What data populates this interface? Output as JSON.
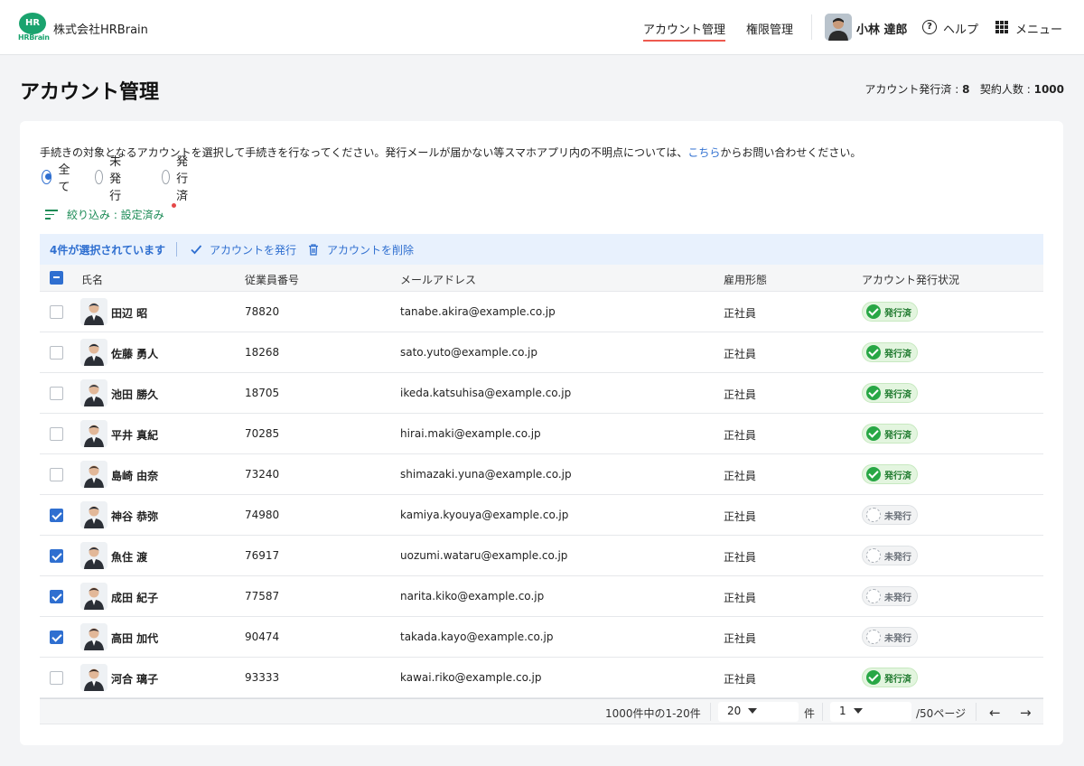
{
  "header": {
    "logo_text": "HR",
    "logo_sub": "HRBrain",
    "company": "株式会社HRBrain",
    "nav": [
      "アカウント管理",
      "権限管理"
    ],
    "user_name": "小林 達郎",
    "help_label": "ヘルプ",
    "menu_label": "メニュー"
  },
  "page": {
    "title": "アカウント管理",
    "issued_label": "アカウント発行済 : ",
    "issued_count": "8",
    "contract_label": "契約人数 : ",
    "contract_count": "1000"
  },
  "card": {
    "desc_before": "手続きの対象となるアカウントを選択して手続きを行なってください。発行メールが届かない等スマホアプリ内の不明点については、",
    "desc_link": "こちら",
    "desc_after": "からお問い合わせください。",
    "radios": [
      {
        "label": "全て",
        "checked": true
      },
      {
        "label": "未発行",
        "checked": false
      },
      {
        "label": "発行済",
        "checked": false
      }
    ],
    "filter_label": "絞り込み : 設定済み"
  },
  "selection": {
    "count_text": "4件が選択されています",
    "issue_label": "アカウントを発行",
    "delete_label": "アカウントを削除"
  },
  "table": {
    "columns": [
      "氏名",
      "従業員番号",
      "メールアドレス",
      "雇用形態",
      "アカウント発行状況"
    ],
    "rows": [
      {
        "name": "田辺 昭",
        "id": "78820",
        "email": "tanabe.akira@example.co.jp",
        "type": "正社員",
        "status": "発行済",
        "checked": false
      },
      {
        "name": "佐藤 勇人",
        "id": "18268",
        "email": "sato.yuto@example.co.jp",
        "type": "正社員",
        "status": "発行済",
        "checked": false
      },
      {
        "name": "池田 勝久",
        "id": "18705",
        "email": "ikeda.katsuhisa@example.co.jp",
        "type": "正社員",
        "status": "発行済",
        "checked": false
      },
      {
        "name": "平井 真紀",
        "id": "70285",
        "email": "hirai.maki@example.co.jp",
        "type": "正社員",
        "status": "発行済",
        "checked": false
      },
      {
        "name": "島崎 由奈",
        "id": "73240",
        "email": "shimazaki.yuna@example.co.jp",
        "type": "正社員",
        "status": "発行済",
        "checked": false
      },
      {
        "name": "神谷 恭弥",
        "id": "74980",
        "email": "kamiya.kyouya@example.co.jp",
        "type": "正社員",
        "status": "未発行",
        "checked": true
      },
      {
        "name": "魚住 渡",
        "id": "76917",
        "email": "uozumi.wataru@example.co.jp",
        "type": "正社員",
        "status": "未発行",
        "checked": true
      },
      {
        "name": "成田 紀子",
        "id": "77587",
        "email": "narita.kiko@example.co.jp",
        "type": "正社員",
        "status": "未発行",
        "checked": true
      },
      {
        "name": "高田 加代",
        "id": "90474",
        "email": "takada.kayo@example.co.jp",
        "type": "正社員",
        "status": "未発行",
        "checked": true
      },
      {
        "name": "河合 璃子",
        "id": "93333",
        "email": "kawai.riko@example.co.jp",
        "type": "正社員",
        "status": "発行済",
        "checked": false
      }
    ]
  },
  "pagination": {
    "range_text": "1000件中の1-20件",
    "per_page": "20",
    "per_page_unit": "件",
    "page": "1",
    "total_pages": "/50ページ",
    "prev": "←",
    "next": "→"
  },
  "colors": {
    "accent": "#2f6fd0",
    "brand": "#1aa36e",
    "issued": "#28a745",
    "nav_underline": "#ee5a4f"
  }
}
